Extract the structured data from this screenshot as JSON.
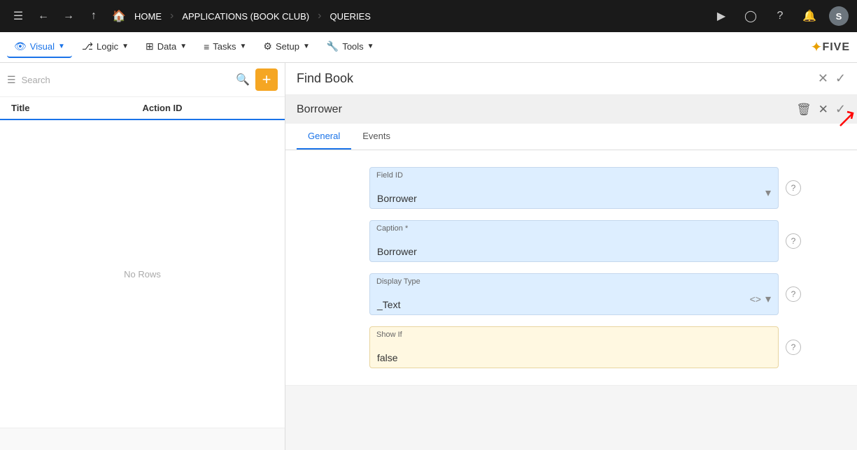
{
  "topnav": {
    "menu_icon": "☰",
    "back_icon": "←",
    "forward_icon": "→",
    "up_icon": "↑",
    "home_label": "HOME",
    "sep1": "›",
    "app_label": "APPLICATIONS (BOOK CLUB)",
    "sep2": "›",
    "queries_label": "QUERIES",
    "play_icon": "▶",
    "search_icon": "◯",
    "help_icon": "?",
    "bell_icon": "🔔",
    "avatar_label": "S"
  },
  "toolbar": {
    "visual_label": "Visual",
    "logic_label": "Logic",
    "data_label": "Data",
    "tasks_label": "Tasks",
    "setup_label": "Setup",
    "tools_label": "Tools",
    "logo_star": "✦",
    "logo_text": "FIVE"
  },
  "leftpanel": {
    "filter_icon": "☰",
    "search_placeholder": "Search",
    "search_icon": "🔍",
    "add_icon": "+",
    "col_title": "Title",
    "col_action_id": "Action ID",
    "empty_label": "No Rows"
  },
  "rightpanel": {
    "title": "Find Book",
    "close_icon": "✕",
    "check_icon": "✓"
  },
  "subpanel": {
    "title": "Borrower",
    "delete_icon": "🗑",
    "close_icon": "✕",
    "check_icon": "✓"
  },
  "tabs": [
    {
      "label": "General",
      "active": true
    },
    {
      "label": "Events",
      "active": false
    }
  ],
  "form": {
    "field_id_label": "Field ID",
    "field_id_value": "Borrower",
    "caption_label": "Caption *",
    "caption_value": "Borrower",
    "display_type_label": "Display Type",
    "display_type_value": "_Text",
    "show_if_label": "Show If",
    "show_if_value": "false"
  }
}
